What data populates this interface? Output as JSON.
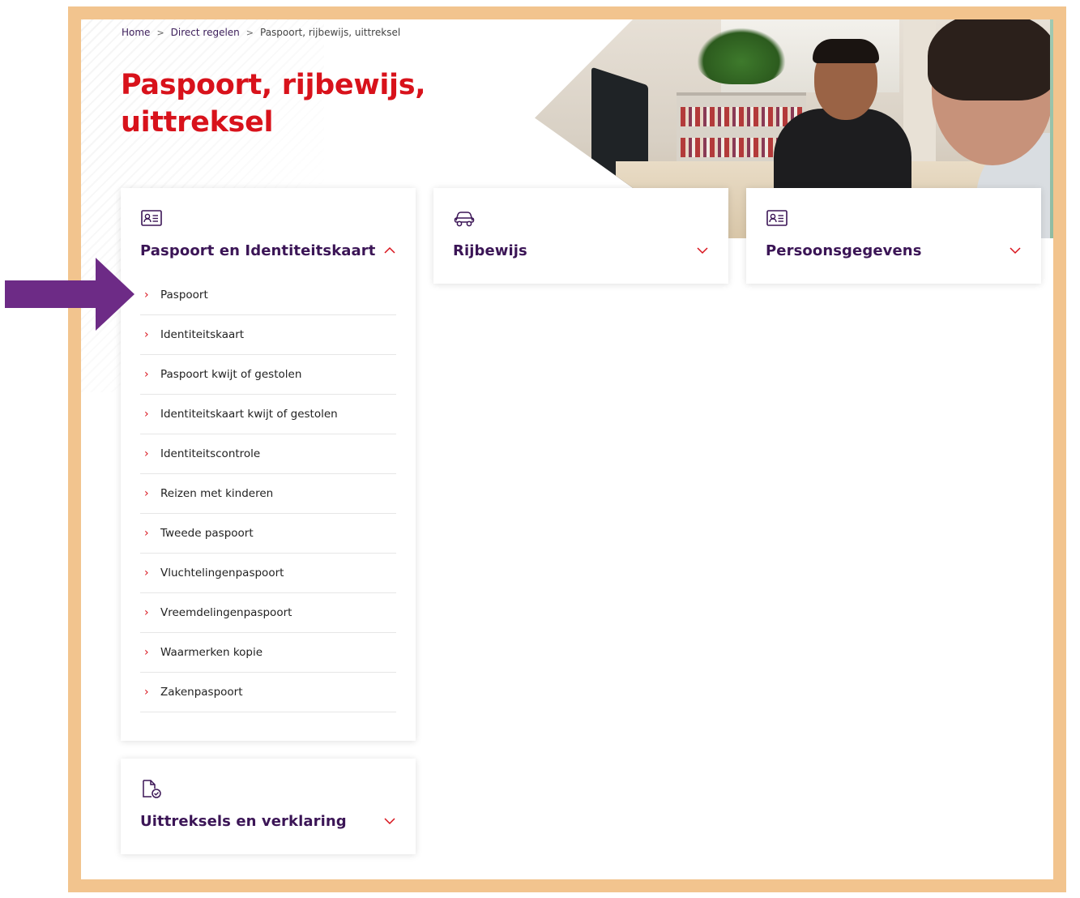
{
  "breadcrumb": {
    "items": [
      "Home",
      "Direct regelen"
    ],
    "current": "Paspoort, rijbewijs, uittreksel"
  },
  "page": {
    "title_line1": "Paspoort, rijbewijs,",
    "title_line2": "uittreksel"
  },
  "cards": [
    {
      "icon": "id-card-icon",
      "title": "Paspoort en Identiteitskaart",
      "expanded": true,
      "items": [
        "Paspoort",
        "Identiteitskaart",
        "Paspoort kwijt of gestolen",
        "Identiteitskaart kwijt of gestolen",
        "Identiteitscontrole",
        "Reizen met kinderen",
        "Tweede paspoort",
        "Vluchtelingenpaspoort",
        "Vreemdelingenpaspoort",
        "Waarmerken kopie",
        "Zakenpaspoort"
      ]
    },
    {
      "icon": "car-icon",
      "title": "Rijbewijs",
      "expanded": false
    },
    {
      "icon": "id-card-icon",
      "title": "Persoonsgegevens",
      "expanded": false
    },
    {
      "icon": "document-check-icon",
      "title": "Uittreksels en verklaring",
      "expanded": false
    }
  ],
  "colors": {
    "frame": "#f2c48e",
    "title_red": "#d8121b",
    "heading_purple": "#3b1556",
    "arrow_purple": "#6d2b86"
  }
}
